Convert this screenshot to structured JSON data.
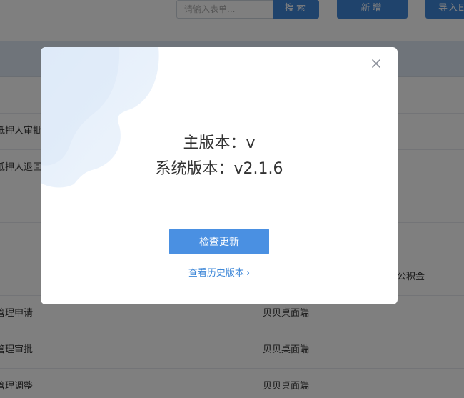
{
  "toolbar": {
    "search_placeholder": "请输入表单...",
    "search_button": "搜索",
    "add_button": "新增",
    "import_button": "导入E"
  },
  "table": {
    "rows": [
      {
        "col1": "",
        "col2": "",
        "col3": ""
      },
      {
        "col1": "抵押人审批",
        "col2": "",
        "col3": ""
      },
      {
        "col1": "抵押人退回",
        "col2": "",
        "col3": ""
      },
      {
        "col1": "",
        "col2": "",
        "col3": ""
      },
      {
        "col1": "",
        "col2": "",
        "col3": ""
      },
      {
        "col1": "",
        "col2": "",
        "col3": "公积金"
      },
      {
        "col1": "管理申请",
        "col2": "贝贝桌面端",
        "col3": ""
      },
      {
        "col1": "管理审批",
        "col2": "贝贝桌面端",
        "col3": ""
      },
      {
        "col1": "管理调整",
        "col2": "贝贝桌面端",
        "col3": ""
      }
    ]
  },
  "modal": {
    "main_version": "主版本：v",
    "system_version": "系统版本：v2.1.6",
    "check_update_button": "检查更新",
    "history_link": "查看历史版本",
    "close_icon": "close-icon",
    "accent_color": "#4a90e2"
  }
}
